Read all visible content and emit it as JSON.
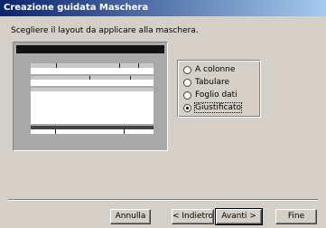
{
  "window": {
    "title": "Creazione guidata Maschera"
  },
  "instruction": "Scegliere il layout da applicare alla maschera.",
  "layout_options": [
    {
      "label": "A colonne",
      "selected": false
    },
    {
      "label": "Tabulare",
      "selected": false
    },
    {
      "label": "Foglio dati",
      "selected": false
    },
    {
      "label": "Giustificato",
      "selected": true
    }
  ],
  "buttons": {
    "cancel": "Annulla",
    "back": "< Indietro",
    "next": "Avanti >",
    "finish": "Fine"
  }
}
